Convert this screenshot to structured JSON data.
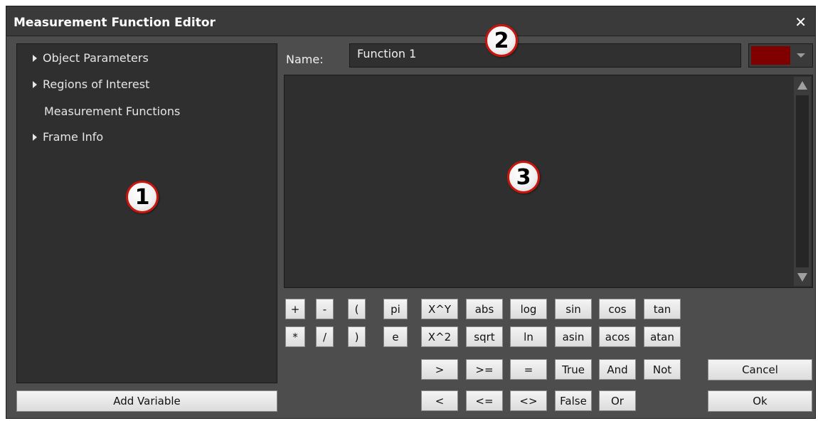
{
  "window": {
    "title": "Measurement Function Editor",
    "close_glyph": "✕"
  },
  "tree": {
    "items": [
      {
        "label": "Object Parameters",
        "expandable": true
      },
      {
        "label": "Regions of Interest",
        "expandable": true
      },
      {
        "label": "Measurement Functions",
        "expandable": false
      },
      {
        "label": "Frame Info",
        "expandable": true
      }
    ],
    "add_variable_label": "Add Variable"
  },
  "name_field": {
    "label": "Name:",
    "value": "Function 1"
  },
  "color_picker": {
    "color": "#800000"
  },
  "keypad": {
    "row1": [
      "+",
      "-",
      "(",
      "pi",
      "X^Y",
      "abs",
      "log",
      "sin",
      "cos",
      "tan"
    ],
    "row2": [
      "*",
      "/",
      ")",
      "e",
      "X^2",
      "sqrt",
      "ln",
      "asin",
      "acos",
      "atan"
    ],
    "row3": [
      ">",
      ">=",
      "=",
      "True",
      "And",
      "Not"
    ],
    "row4": [
      "<",
      "<=",
      "<>",
      "False",
      "Or"
    ]
  },
  "dialog_buttons": {
    "cancel": "Cancel",
    "ok": "Ok"
  },
  "callouts": [
    "1",
    "2",
    "3"
  ]
}
